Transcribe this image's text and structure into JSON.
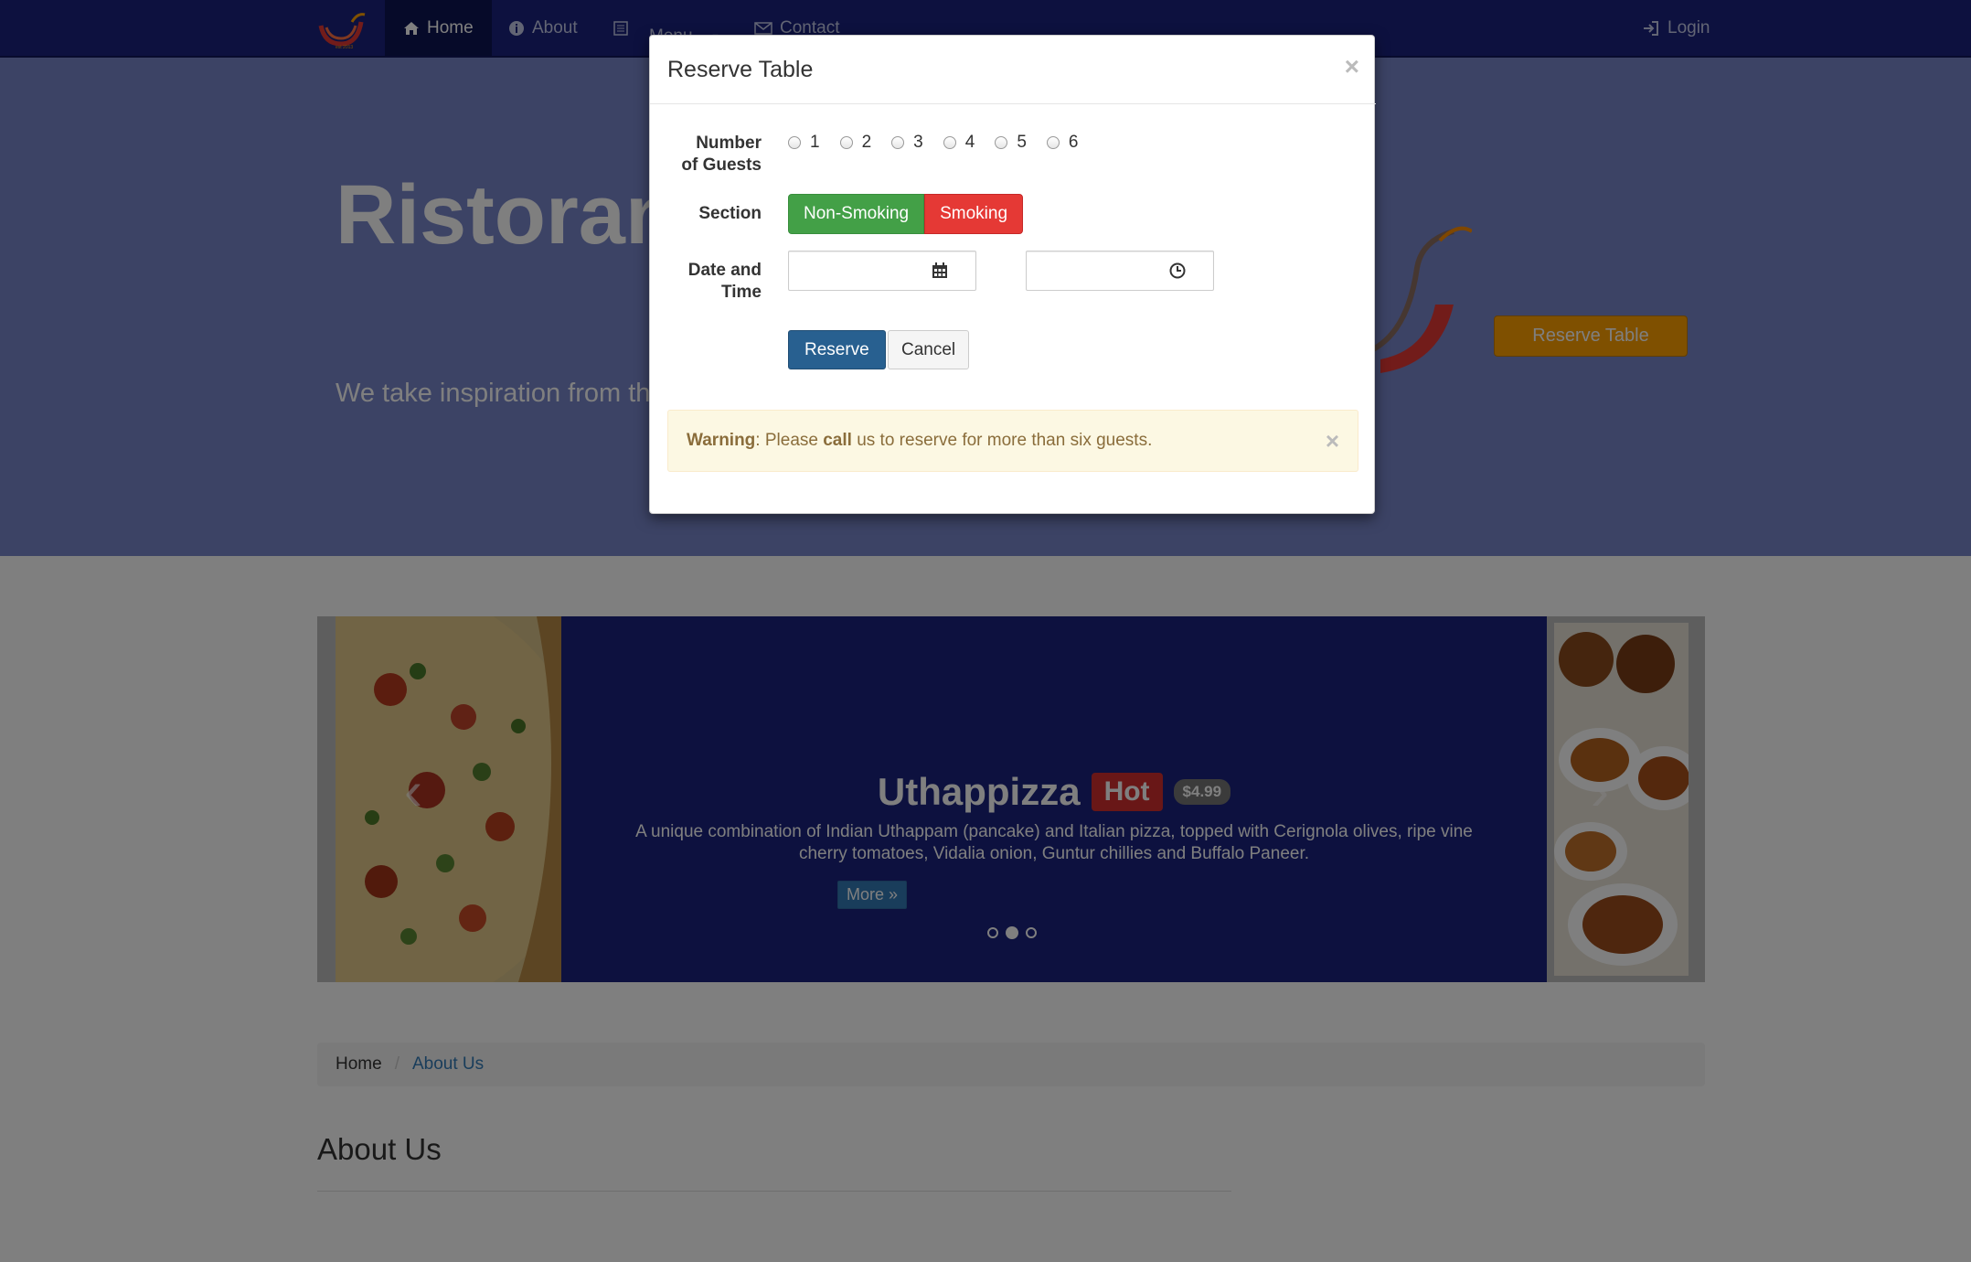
{
  "nav": {
    "home": "Home",
    "about": "About",
    "menu": "Menu",
    "contact": "Contact",
    "login": "Login"
  },
  "jumbotron": {
    "title": "Ristorant",
    "text": "We take inspiration from the experience. Our lipsmacking",
    "reserve_button": "Reserve Table"
  },
  "carousel": {
    "title": "Uthappizza",
    "badge": "Hot",
    "price": "$4.99",
    "description": "A unique combination of Indian Uthappam (pancake) and Italian pizza, topped with Cerignola olives, ripe vine cherry tomatoes, Vidalia onion, Guntur chillies and Buffalo Paneer.",
    "more": "More »",
    "prev": "‹",
    "next": "›"
  },
  "breadcrumb": {
    "home": "Home",
    "separator": "/",
    "active": "About Us"
  },
  "about_heading": "About Us",
  "modal": {
    "title": "Reserve Table",
    "close": "×",
    "guests_label_1": "Number",
    "guests_label_2": "of Guests",
    "guest_options": [
      "1",
      "2",
      "3",
      "4",
      "5",
      "6"
    ],
    "section_label": "Section",
    "non_smoking": "Non-Smoking",
    "smoking": "Smoking",
    "datetime_label_1": "Date and",
    "datetime_label_2": "Time",
    "date_value": "",
    "time_value": "",
    "reserve": "Reserve",
    "cancel": "Cancel",
    "alert": {
      "strong": "Warning",
      "text_1": ": Please ",
      "call": "call",
      "text_2": " us to reserve for more than six guests.",
      "close": "×"
    }
  },
  "colors": {
    "navbar": "#1a237e",
    "jumbotron": "#7986cb",
    "accent": "#ffa000",
    "success": "#43a047",
    "danger": "#e53935",
    "primary": "#286090"
  }
}
